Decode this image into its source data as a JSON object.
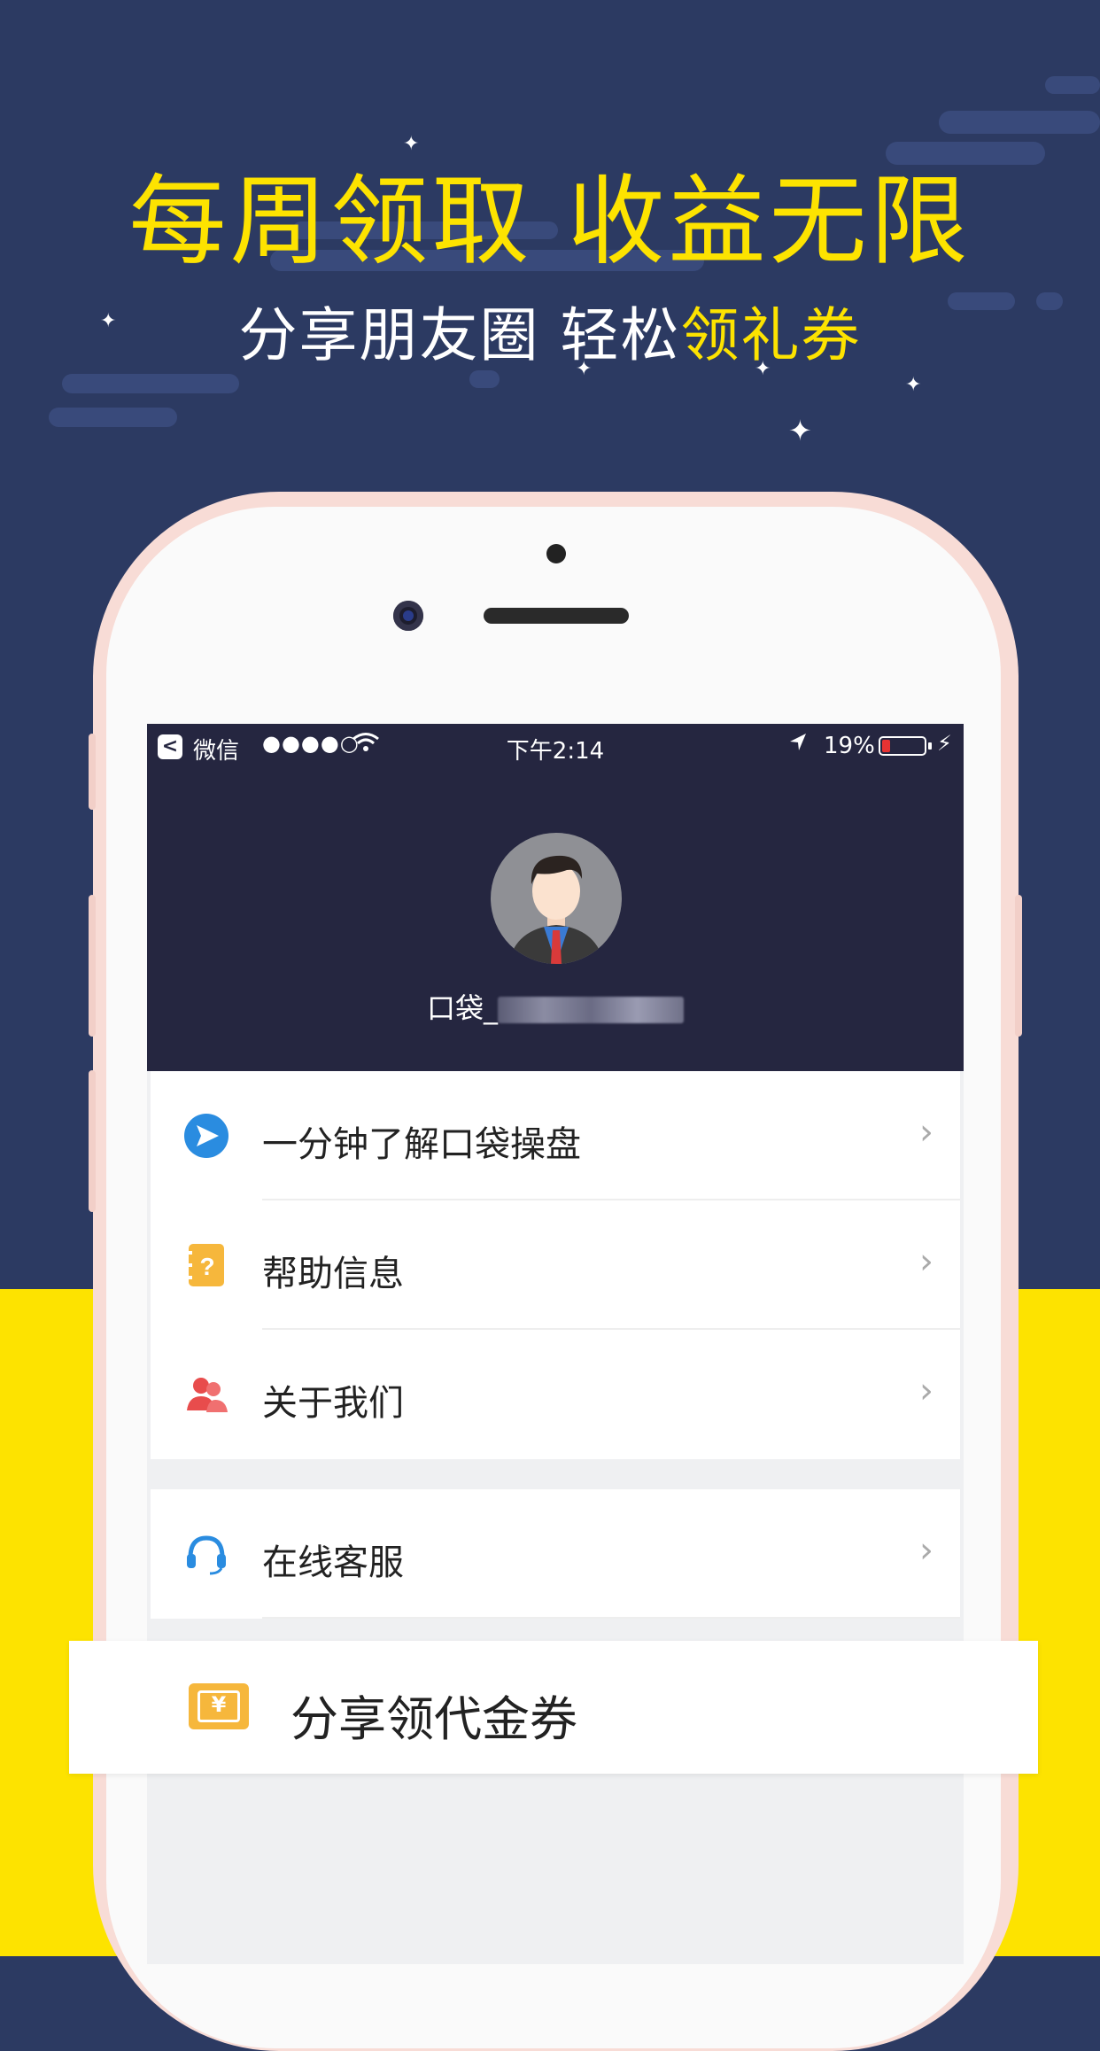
{
  "promo": {
    "headline": "每周领取 收益无限",
    "subline_part1": "分享朋友圈 轻松",
    "subline_part2": "领礼券"
  },
  "status_bar": {
    "back_glyph": "<",
    "app_name": "微信",
    "signal": "●●●●○",
    "time": "下午2:14",
    "battery_percent": "19%",
    "battery_level": 0.19
  },
  "profile": {
    "username_prefix": "口袋_"
  },
  "menu": {
    "items": [
      {
        "label": "一分钟了解口袋操盘",
        "icon": "play-circle-icon"
      },
      {
        "label": "帮助信息",
        "icon": "help-notebook-icon"
      },
      {
        "label": "关于我们",
        "icon": "users-icon"
      }
    ],
    "group2": [
      {
        "label": "在线客服",
        "icon": "headset-icon"
      }
    ],
    "chevron": "›"
  },
  "share_banner": {
    "label": "分享领代金券",
    "icon": "coupon-icon",
    "icon_glyph": "¥"
  },
  "colors": {
    "navy": "#2c3a62",
    "yellow": "#fde300",
    "screen_header": "#252640"
  }
}
